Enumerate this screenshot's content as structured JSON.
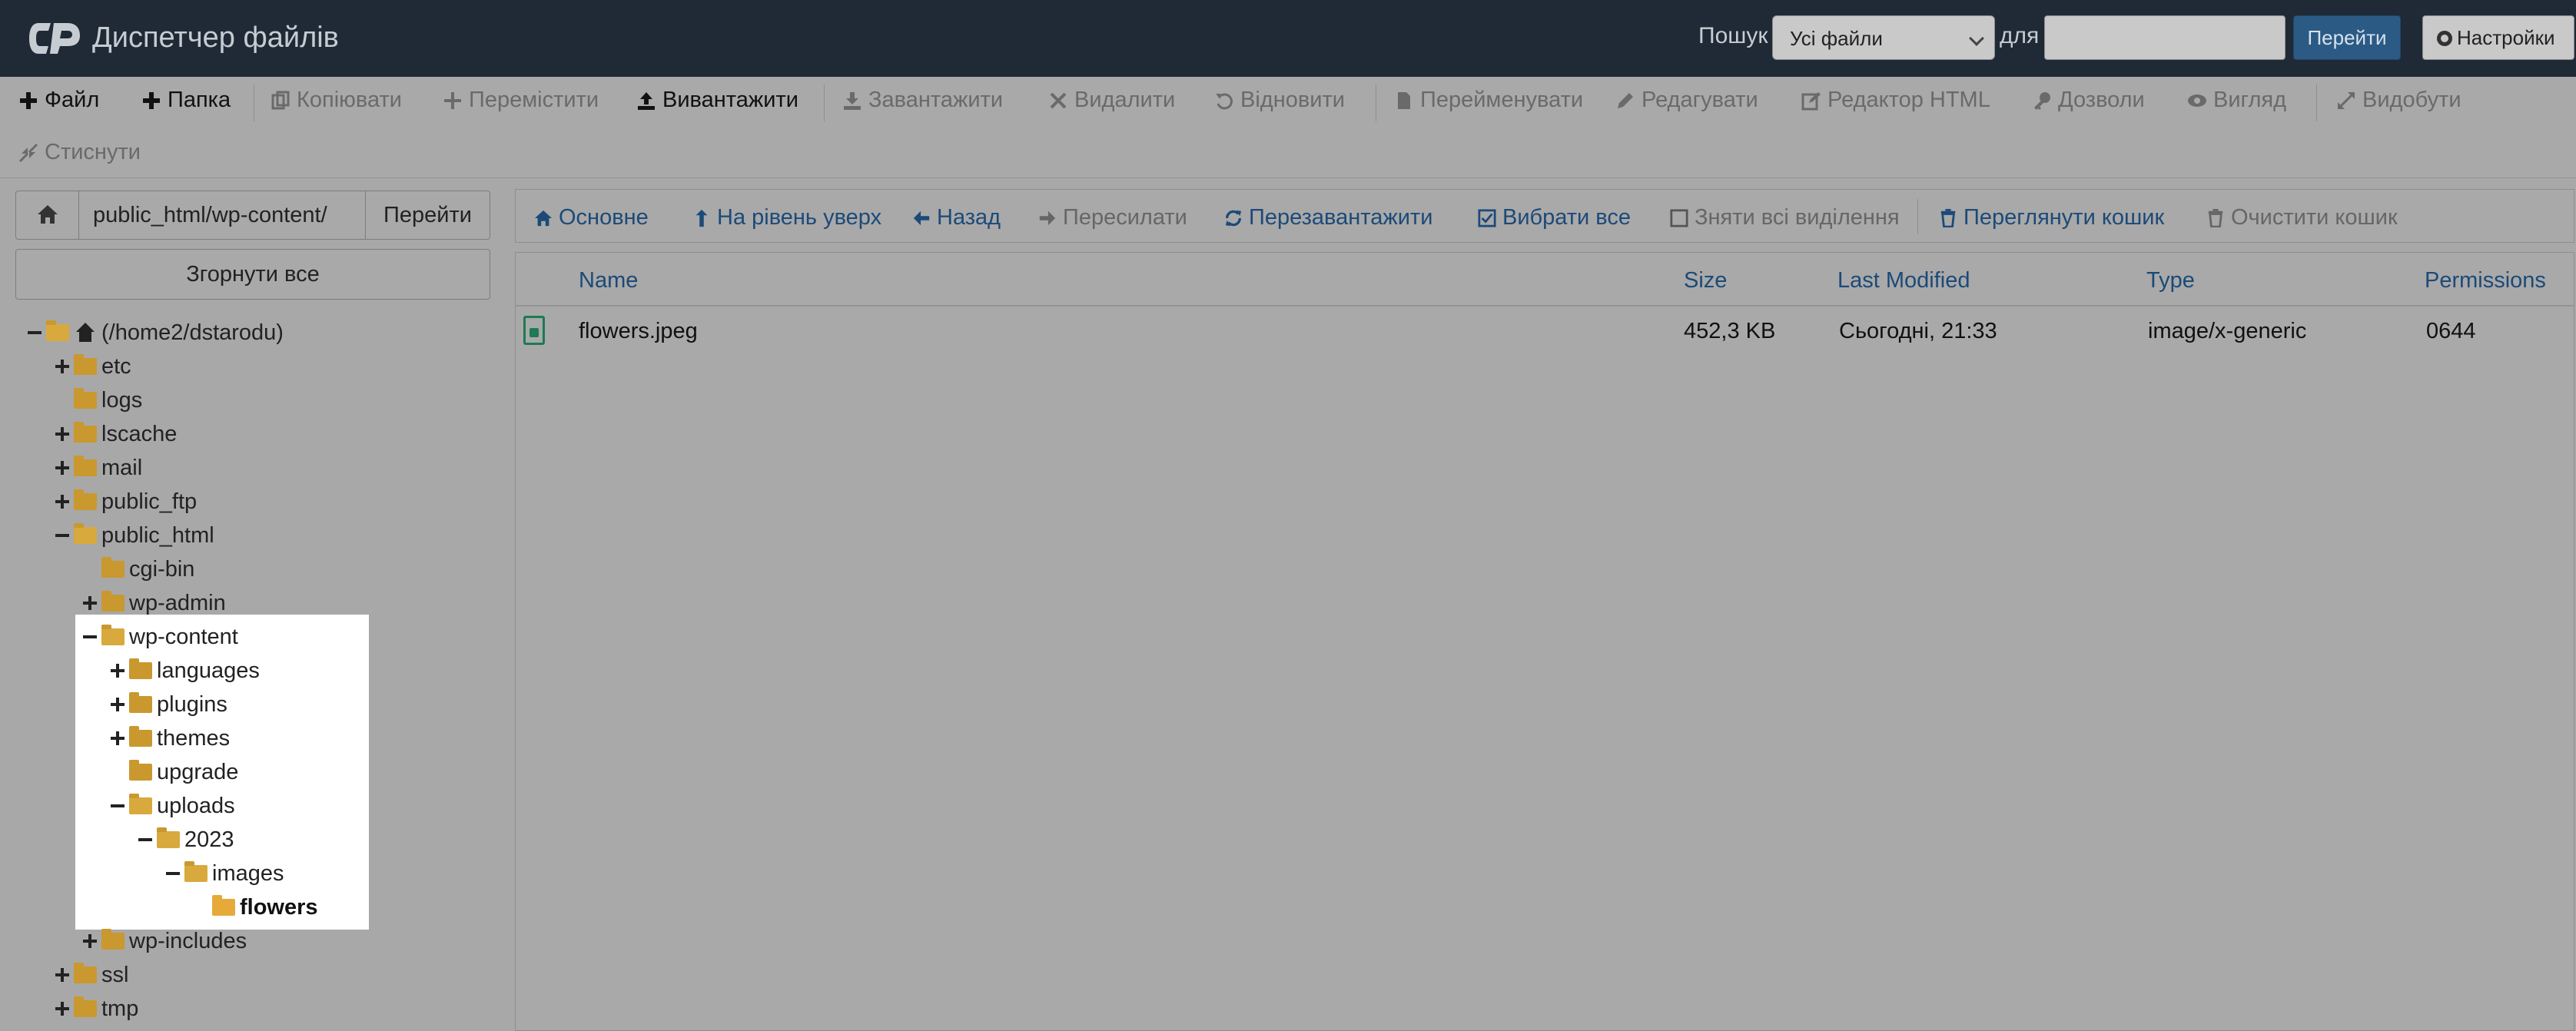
{
  "header": {
    "app_title": "Диспетчер файлів",
    "search_label": "Пошук",
    "search_scope": "Усі файли",
    "for_label": "для",
    "search_value": "",
    "search_go": "Перейти",
    "settings": "Настройки"
  },
  "toolbar": {
    "items": [
      {
        "label": "Файл",
        "icon": "plus-icon",
        "active": true
      },
      {
        "label": "Папка",
        "icon": "plus-icon",
        "active": true
      },
      {
        "label": "Копіювати",
        "icon": "copy-icon",
        "active": false
      },
      {
        "label": "Перемістити",
        "icon": "move-icon",
        "active": false
      },
      {
        "label": "Вивантажити",
        "icon": "upload-icon",
        "active": true
      },
      {
        "label": "Завантажити",
        "icon": "download-icon",
        "active": false
      },
      {
        "label": "Видалити",
        "icon": "close-icon",
        "active": false
      },
      {
        "label": "Відновити",
        "icon": "undo-icon",
        "active": false
      },
      {
        "label": "Перейменувати",
        "icon": "file-icon",
        "active": false
      },
      {
        "label": "Редагувати",
        "icon": "pencil-icon",
        "active": false
      },
      {
        "label": "Редактор HTML",
        "icon": "edit-icon",
        "active": false
      },
      {
        "label": "Дозволи",
        "icon": "key-icon",
        "active": false
      },
      {
        "label": "Вигляд",
        "icon": "eye-icon",
        "active": false
      },
      {
        "label": "Видобути",
        "icon": "expand-icon",
        "active": false
      },
      {
        "label": "Стиснути",
        "icon": "compress-icon",
        "active": false
      }
    ]
  },
  "path_bar": {
    "path": "public_html/wp-content/",
    "go": "Перейти"
  },
  "collapse_all": "Згорнути все",
  "tree": [
    {
      "label": "(/home2/dstarodu)",
      "toggle": "minus",
      "icon": "home",
      "level": 0
    },
    {
      "label": "etc",
      "toggle": "plus",
      "icon": "folder",
      "level": 1
    },
    {
      "label": "logs",
      "toggle": "none",
      "icon": "folder",
      "level": 1
    },
    {
      "label": "lscache",
      "toggle": "plus",
      "icon": "folder",
      "level": 1
    },
    {
      "label": "mail",
      "toggle": "plus",
      "icon": "folder",
      "level": 1
    },
    {
      "label": "public_ftp",
      "toggle": "plus",
      "icon": "folder",
      "level": 1
    },
    {
      "label": "public_html",
      "toggle": "minus",
      "icon": "folder-open",
      "level": 1
    },
    {
      "label": "cgi-bin",
      "toggle": "none",
      "icon": "folder",
      "level": 2
    },
    {
      "label": "wp-admin",
      "toggle": "plus",
      "icon": "folder",
      "level": 2
    },
    {
      "label": "wp-content",
      "toggle": "minus",
      "icon": "folder-open",
      "level": 2
    },
    {
      "label": "languages",
      "toggle": "plus",
      "icon": "folder",
      "level": 3
    },
    {
      "label": "plugins",
      "toggle": "plus",
      "icon": "folder",
      "level": 3
    },
    {
      "label": "themes",
      "toggle": "plus",
      "icon": "folder",
      "level": 3
    },
    {
      "label": "upgrade",
      "toggle": "none",
      "icon": "folder",
      "level": 3
    },
    {
      "label": "uploads",
      "toggle": "minus",
      "icon": "folder-open",
      "level": 3
    },
    {
      "label": "2023",
      "toggle": "minus",
      "icon": "folder-open",
      "level": 4
    },
    {
      "label": "images",
      "toggle": "minus",
      "icon": "folder-open",
      "level": 5
    },
    {
      "label": "flowers",
      "toggle": "none",
      "icon": "folder",
      "level": 6,
      "selected": true
    },
    {
      "label": "wp-includes",
      "toggle": "plus",
      "icon": "folder",
      "level": 2
    },
    {
      "label": "ssl",
      "toggle": "plus",
      "icon": "folder",
      "level": 1
    },
    {
      "label": "tmp",
      "toggle": "plus",
      "icon": "folder",
      "level": 1
    }
  ],
  "nav": {
    "items": [
      {
        "label": "Основне",
        "icon": "home-icon",
        "dim": false
      },
      {
        "label": "На рівень уверх",
        "icon": "level-up-icon",
        "dim": false
      },
      {
        "label": "Назад",
        "icon": "arrow-left-icon",
        "dim": false
      },
      {
        "label": "Пересилати",
        "icon": "arrow-right-icon",
        "dim": true
      },
      {
        "label": "Перезавантажити",
        "icon": "refresh-icon",
        "dim": false
      },
      {
        "label": "Вибрати все",
        "icon": "checkbox-checked-icon",
        "dim": false
      },
      {
        "label": "Зняти всі виділення",
        "icon": "checkbox-empty-icon",
        "dim": true
      },
      {
        "label": "Переглянути кошик",
        "icon": "trash-icon",
        "dim": false
      },
      {
        "label": "Очистити кошик",
        "icon": "trash-icon",
        "dim": true
      }
    ]
  },
  "table": {
    "columns": [
      "Name",
      "Size",
      "Last Modified",
      "Type",
      "Permissions"
    ],
    "rows": [
      {
        "name": "flowers.jpeg",
        "size": "452,3 KB",
        "modified": "Сьогодні, 21:33",
        "type": "image/x-generic",
        "permissions": "0644"
      }
    ]
  }
}
